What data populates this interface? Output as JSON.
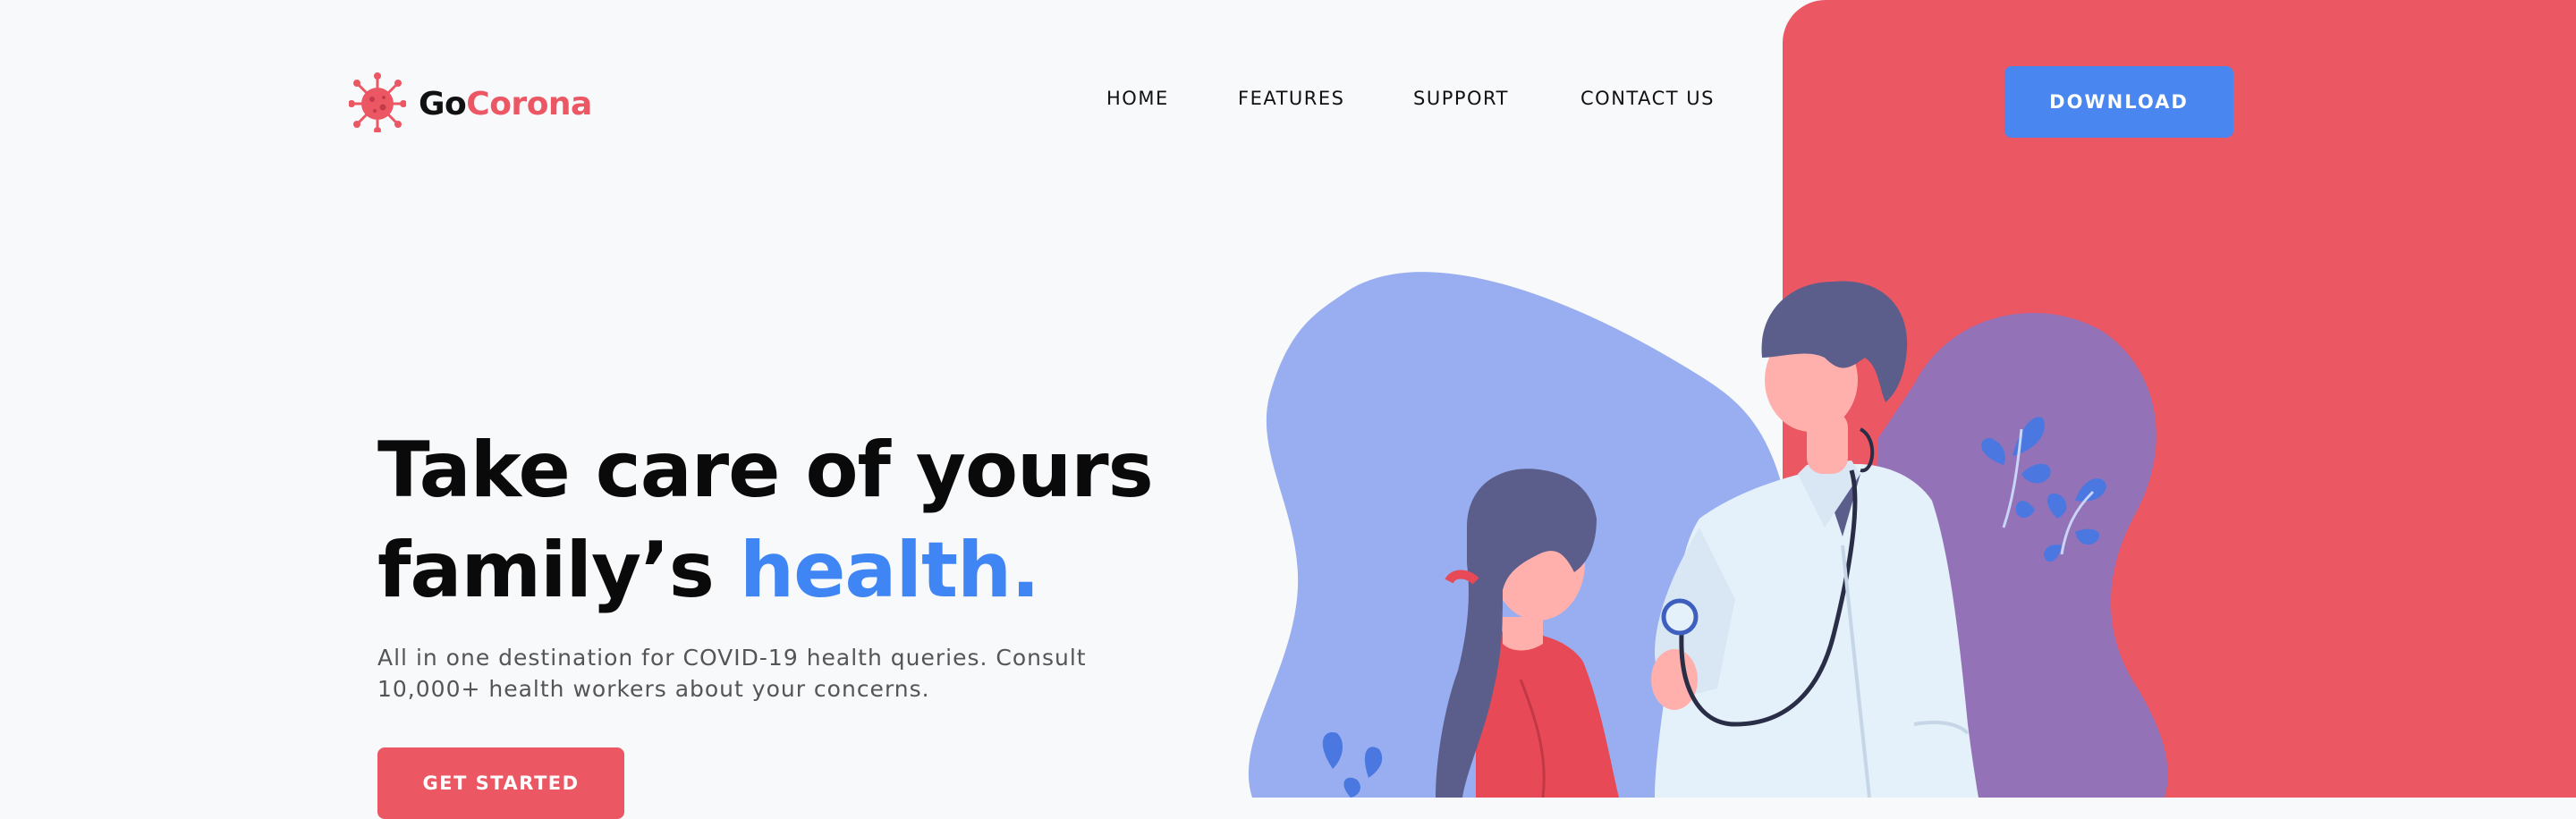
{
  "brand": {
    "name_part1": "Go",
    "name_part2": "Corona",
    "icon": "virus-icon",
    "color": "#eb5763"
  },
  "nav": {
    "items": [
      {
        "label": "HOME"
      },
      {
        "label": "FEATURES"
      },
      {
        "label": "SUPPORT"
      },
      {
        "label": "CONTACT US"
      }
    ],
    "download_label": "DOWNLOAD"
  },
  "hero": {
    "headline_line1": "Take care of yours",
    "headline_line2_plain": "family’s ",
    "headline_line2_accent": "health.",
    "subtext_line1": "All in one destination for COVID-19 health queries. Consult",
    "subtext_line2": "10,000+ health workers about your concerns.",
    "cta_label": "GET STARTED"
  },
  "colors": {
    "accent_blue": "#3f86f4",
    "accent_red": "#eb5763",
    "background": "#f8f9fb"
  }
}
